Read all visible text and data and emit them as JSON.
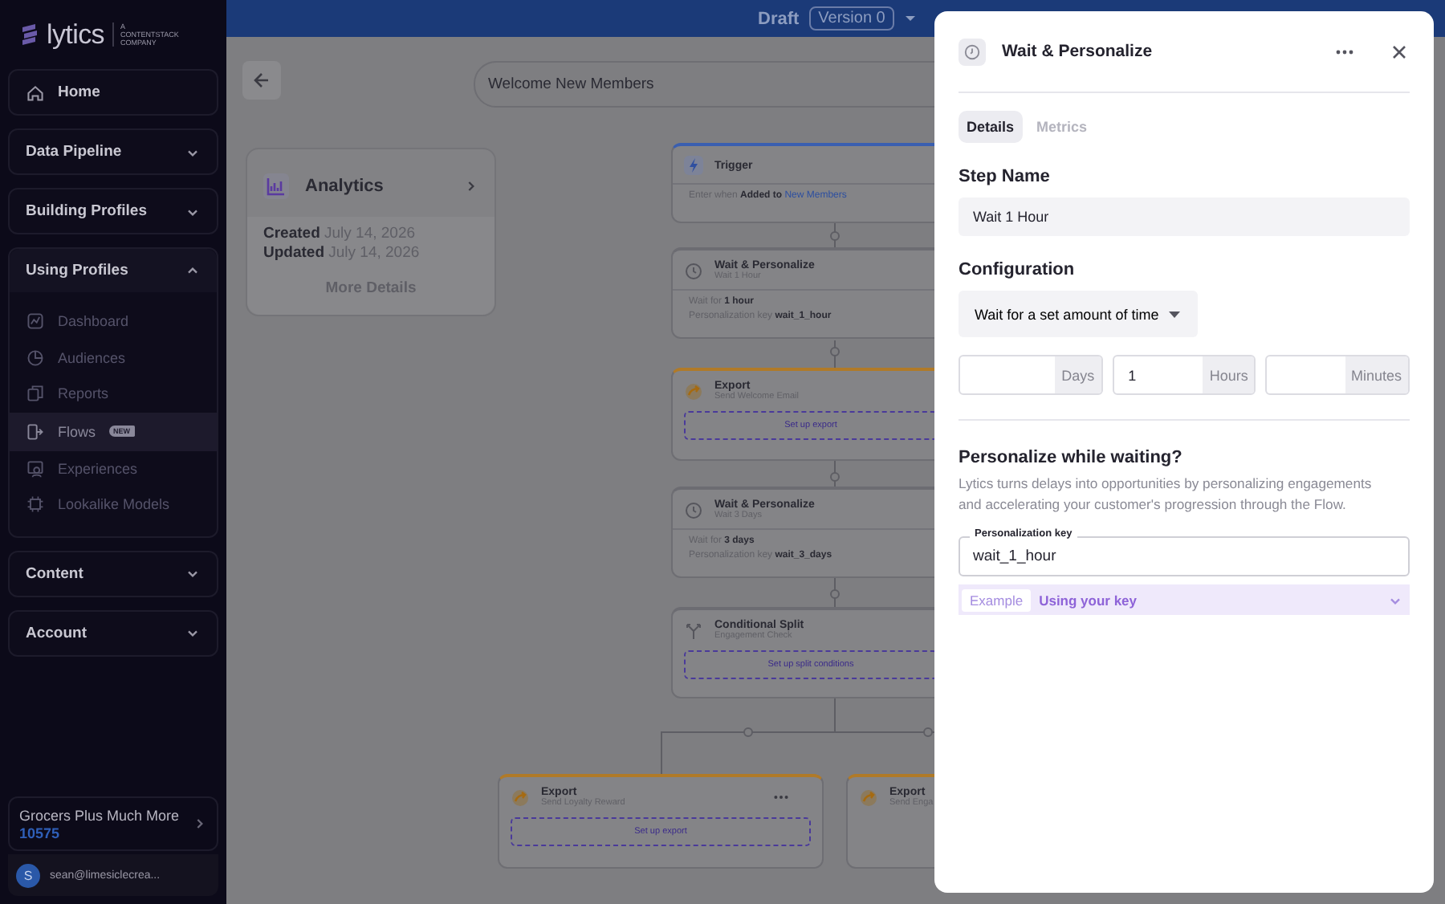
{
  "sidebar": {
    "logo": {
      "name": "lytics",
      "tagline": "A CONTENTSTACK COMPANY"
    },
    "nav": [
      {
        "label": "Home",
        "kind": "link"
      },
      {
        "label": "Data Pipeline",
        "kind": "group",
        "expanded": false
      },
      {
        "label": "Building Profiles",
        "kind": "group",
        "expanded": false
      },
      {
        "label": "Using Profiles",
        "kind": "group",
        "expanded": true,
        "children": [
          {
            "label": "Dashboard",
            "selected": false
          },
          {
            "label": "Audiences",
            "selected": false
          },
          {
            "label": "Reports",
            "selected": false
          },
          {
            "label": "Flows",
            "selected": true,
            "badge": "NEW"
          },
          {
            "label": "Experiences",
            "selected": false
          },
          {
            "label": "Lookalike Models",
            "selected": false
          }
        ]
      },
      {
        "label": "Content",
        "kind": "group",
        "expanded": false
      },
      {
        "label": "Account",
        "kind": "group",
        "expanded": false
      }
    ],
    "account": {
      "name": "Grocers Plus Much More",
      "id": "10575"
    },
    "user": {
      "initial": "S",
      "email": "sean@limesiclecrea..."
    }
  },
  "top_bar": {
    "status": "Draft",
    "version": "Version 0"
  },
  "canvas": {
    "flow_name": "Welcome New Members",
    "summary_card": {
      "title": "Analytics",
      "created_label": "Created",
      "created": "July 14, 2026",
      "updated_label": "Updated",
      "updated": "July 14, 2026",
      "more": "More Details"
    },
    "nodes": [
      {
        "kind": "trigger",
        "title": "Trigger",
        "condition": {
          "label": "Enter when",
          "action": "Added to",
          "target": "New Members"
        }
      },
      {
        "kind": "wait",
        "title": "Wait & Personalize",
        "subtitle": "Wait 1 Hour",
        "details": [
          {
            "label": "Wait for",
            "value": "1 hour"
          },
          {
            "label": "Personalization key",
            "value": "wait_1_hour"
          }
        ]
      },
      {
        "kind": "export",
        "title": "Export",
        "subtitle": "Send Welcome Email",
        "action": "Set up export"
      },
      {
        "kind": "wait",
        "title": "Wait & Personalize",
        "subtitle": "Wait 3 Days",
        "details": [
          {
            "label": "Wait for",
            "value": "3 days"
          },
          {
            "label": "Personalization key",
            "value": "wait_3_days"
          }
        ]
      },
      {
        "kind": "split",
        "title": "Conditional Split",
        "subtitle": "Engagement Check",
        "action": "Set up split conditions"
      },
      {
        "kind": "export",
        "title": "Export",
        "subtitle": "Send Loyalty Reward",
        "action": "Set up export",
        "menu": true
      },
      {
        "kind": "export",
        "title": "Export",
        "subtitle": "Send Enga"
      }
    ]
  },
  "panel": {
    "title": "Wait & Personalize",
    "tabs": [
      {
        "label": "Details",
        "selected": true
      },
      {
        "label": "Metrics",
        "selected": false
      }
    ],
    "step_name": {
      "label": "Step Name",
      "value": "Wait 1 Hour"
    },
    "configuration": {
      "label": "Configuration",
      "mode": "Wait for a set amount of time",
      "durations": [
        {
          "unit": "Days"
        },
        {
          "unit": "Hours",
          "value": "1"
        },
        {
          "unit": "Minutes"
        }
      ]
    },
    "personalize": {
      "heading": "Personalize while waiting?",
      "description": "Lytics turns delays into opportunities by personalizing engagements and accelerating your customer's progression through the Flow.",
      "key_label": "Personalization key",
      "key_value": "wait_1_hour",
      "example": {
        "tag": "Example",
        "label": "Using your key",
        "expanded": false
      }
    }
  }
}
